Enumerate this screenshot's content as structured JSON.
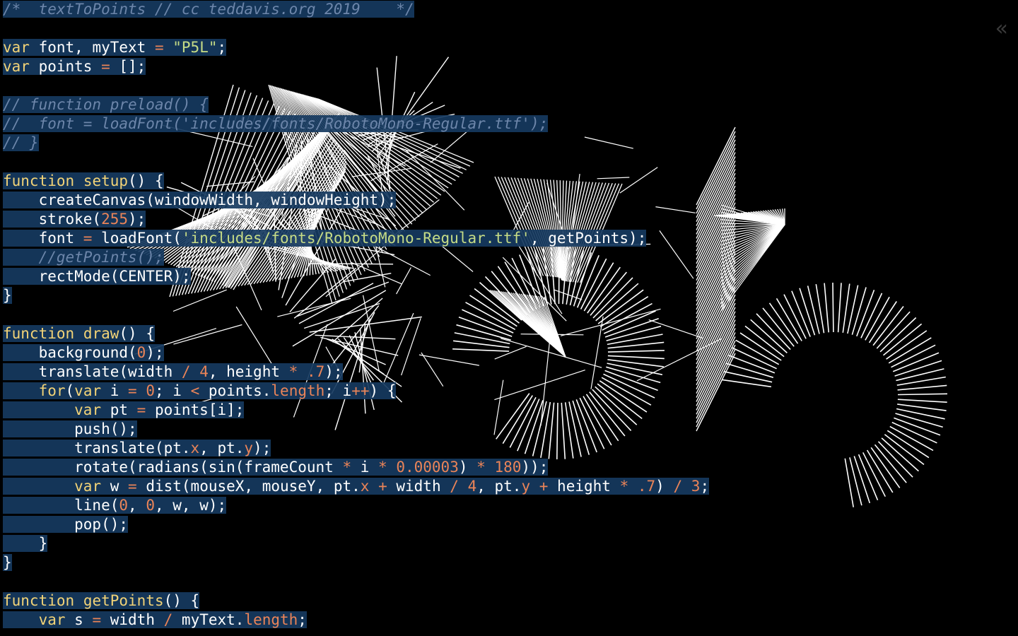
{
  "editor": {
    "collapse_glyph": "«",
    "lines": [
      [
        {
          "t": "/*  textToPoints // cc teddavis.org 2019    */",
          "c": "cm"
        }
      ],
      [],
      [
        {
          "t": "var",
          "c": "kw"
        },
        {
          "t": " font, myText "
        },
        {
          "t": "=",
          "c": "op"
        },
        {
          "t": " "
        },
        {
          "t": "\"P5L\"",
          "c": "str"
        },
        {
          "t": ";"
        }
      ],
      [
        {
          "t": "var",
          "c": "kw"
        },
        {
          "t": " points "
        },
        {
          "t": "=",
          "c": "op"
        },
        {
          "t": " [];"
        }
      ],
      [],
      [
        {
          "t": "// function preload() {",
          "c": "cm"
        }
      ],
      [
        {
          "t": "//  font = loadFont('includes/fonts/RobotoMono-Regular.ttf');",
          "c": "cm"
        }
      ],
      [
        {
          "t": "// }",
          "c": "cm"
        }
      ],
      [],
      [
        {
          "t": "function",
          "c": "kw"
        },
        {
          "t": " "
        },
        {
          "t": "setup",
          "c": "fn"
        },
        {
          "t": "() {"
        }
      ],
      [
        {
          "t": "    createCanvas(windowWidth, windowHeight);"
        }
      ],
      [
        {
          "t": "    stroke("
        },
        {
          "t": "255",
          "c": "num"
        },
        {
          "t": ");"
        }
      ],
      [
        {
          "t": "    font "
        },
        {
          "t": "=",
          "c": "op"
        },
        {
          "t": " loadFont("
        },
        {
          "t": "'includes/fonts/RobotoMono-Regular.ttf'",
          "c": "str"
        },
        {
          "t": ", getPoints);"
        }
      ],
      [
        {
          "t": "    "
        },
        {
          "t": "//getPoints();",
          "c": "cm"
        }
      ],
      [
        {
          "t": "    rectMode(CENTER);"
        }
      ],
      [
        {
          "t": "}"
        }
      ],
      [],
      [
        {
          "t": "function",
          "c": "kw"
        },
        {
          "t": " "
        },
        {
          "t": "draw",
          "c": "fn"
        },
        {
          "t": "() {"
        }
      ],
      [
        {
          "t": "    background("
        },
        {
          "t": "0",
          "c": "num"
        },
        {
          "t": ");"
        }
      ],
      [
        {
          "t": "    translate(width "
        },
        {
          "t": "/",
          "c": "op"
        },
        {
          "t": " "
        },
        {
          "t": "4",
          "c": "num"
        },
        {
          "t": ", height "
        },
        {
          "t": "*",
          "c": "op"
        },
        {
          "t": " "
        },
        {
          "t": ".7",
          "c": "num"
        },
        {
          "t": ");"
        }
      ],
      [
        {
          "t": "    "
        },
        {
          "t": "for",
          "c": "kw"
        },
        {
          "t": "("
        },
        {
          "t": "var",
          "c": "kw"
        },
        {
          "t": " i "
        },
        {
          "t": "=",
          "c": "op"
        },
        {
          "t": " "
        },
        {
          "t": "0",
          "c": "num"
        },
        {
          "t": "; i "
        },
        {
          "t": "<",
          "c": "op"
        },
        {
          "t": " points."
        },
        {
          "t": "length",
          "c": "prop"
        },
        {
          "t": "; i"
        },
        {
          "t": "++",
          "c": "op"
        },
        {
          "t": ") {"
        }
      ],
      [
        {
          "t": "        "
        },
        {
          "t": "var",
          "c": "kw"
        },
        {
          "t": " pt "
        },
        {
          "t": "=",
          "c": "op"
        },
        {
          "t": " points[i];"
        }
      ],
      [
        {
          "t": "        push();"
        }
      ],
      [
        {
          "t": "        translate(pt."
        },
        {
          "t": "x",
          "c": "prop"
        },
        {
          "t": ", pt."
        },
        {
          "t": "y",
          "c": "prop"
        },
        {
          "t": ");"
        }
      ],
      [
        {
          "t": "        rotate(radians(sin(frameCount "
        },
        {
          "t": "*",
          "c": "op"
        },
        {
          "t": " i "
        },
        {
          "t": "*",
          "c": "op"
        },
        {
          "t": " "
        },
        {
          "t": "0.00003",
          "c": "num"
        },
        {
          "t": ") "
        },
        {
          "t": "*",
          "c": "op"
        },
        {
          "t": " "
        },
        {
          "t": "180",
          "c": "num"
        },
        {
          "t": "));"
        }
      ],
      [
        {
          "t": "        "
        },
        {
          "t": "var",
          "c": "kw"
        },
        {
          "t": " w "
        },
        {
          "t": "=",
          "c": "op"
        },
        {
          "t": " dist(mouseX, mouseY, pt."
        },
        {
          "t": "x",
          "c": "prop"
        },
        {
          "t": " "
        },
        {
          "t": "+",
          "c": "op"
        },
        {
          "t": " width "
        },
        {
          "t": "/",
          "c": "op"
        },
        {
          "t": " "
        },
        {
          "t": "4",
          "c": "num"
        },
        {
          "t": ", pt."
        },
        {
          "t": "y",
          "c": "prop"
        },
        {
          "t": " "
        },
        {
          "t": "+",
          "c": "op"
        },
        {
          "t": " height "
        },
        {
          "t": "*",
          "c": "op"
        },
        {
          "t": " "
        },
        {
          "t": ".7",
          "c": "num"
        },
        {
          "t": ") "
        },
        {
          "t": "/",
          "c": "op"
        },
        {
          "t": " "
        },
        {
          "t": "3",
          "c": "num"
        },
        {
          "t": ";"
        }
      ],
      [
        {
          "t": "        line("
        },
        {
          "t": "0",
          "c": "num"
        },
        {
          "t": ", "
        },
        {
          "t": "0",
          "c": "num"
        },
        {
          "t": ", w, w);"
        }
      ],
      [
        {
          "t": "        pop();"
        }
      ],
      [
        {
          "t": "    }"
        }
      ],
      [
        {
          "t": "}"
        }
      ],
      [],
      [
        {
          "t": "function",
          "c": "kw"
        },
        {
          "t": " "
        },
        {
          "t": "getPoints",
          "c": "fn"
        },
        {
          "t": "() {"
        }
      ],
      [
        {
          "t": "    "
        },
        {
          "t": "var",
          "c": "kw"
        },
        {
          "t": " s "
        },
        {
          "t": "=",
          "c": "op"
        },
        {
          "t": " width "
        },
        {
          "t": "/",
          "c": "op"
        },
        {
          "t": " myText."
        },
        {
          "t": "length",
          "c": "prop"
        },
        {
          "t": ";"
        }
      ]
    ]
  },
  "canvas": {
    "background": "#000000",
    "stroke": "#ffffff",
    "artwork_text": "P5L"
  },
  "colors": {
    "highlight": "#163a60",
    "keyword": "#f2d377",
    "string": "#c6dc86",
    "number": "#ea8458",
    "comment": "#6d86aa"
  }
}
